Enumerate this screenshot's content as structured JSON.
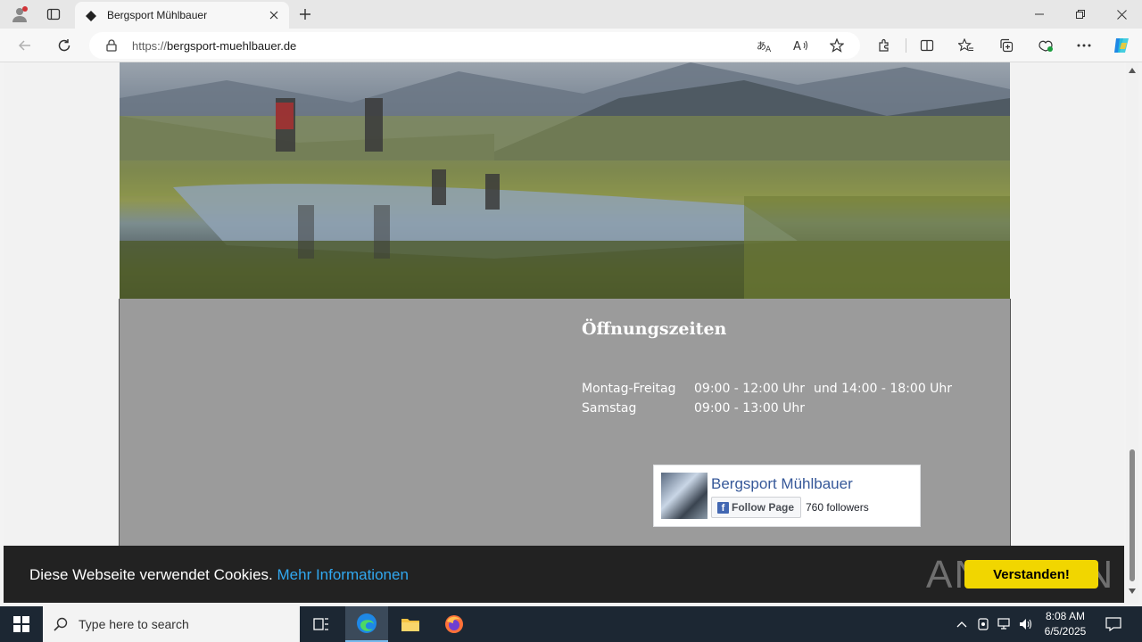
{
  "browser": {
    "tab_title": "Bergsport Mühlbauer",
    "url_scheme": "https://",
    "url_host": "bergsport-muehlbauer.de",
    "icons": [
      "profile-icon",
      "tab-actions-icon",
      "site-favicon",
      "close-icon",
      "new-tab-icon",
      "minimize-icon",
      "restore-icon",
      "window-close-icon",
      "back-icon",
      "refresh-icon",
      "lock-icon",
      "translate-icon",
      "read-aloud-icon",
      "favorite-star-icon",
      "extensions-icon",
      "split-screen-icon",
      "favorites-icon",
      "collections-icon",
      "performance-icon",
      "more-icon",
      "copilot-icon"
    ]
  },
  "page": {
    "hours_title": "Öffnungszeiten",
    "hours": [
      {
        "day": "Montag-Freitag",
        "time": "09:00 - 12:00 Uhr",
        "extra": "und 14:00 - 18:00 Uhr"
      },
      {
        "day": "Samstag",
        "time": "09:00 - 13:00 Uhr",
        "extra": ""
      }
    ],
    "facebook": {
      "page_name": "Bergsport Mühlbauer",
      "follow_label": "Follow Page",
      "followers": "760 followers"
    },
    "cookie": {
      "text": "Diese Webseite verwendet Cookies.",
      "link": "Mehr Informationen",
      "button": "Verstanden!"
    },
    "watermark": "ANY RUN"
  },
  "taskbar": {
    "search_placeholder": "Type here to search",
    "time": "8:08 AM",
    "date": "6/5/2025"
  },
  "colors": {
    "content_bg": "#9b9b9b",
    "cookie_bg": "#222222",
    "cookie_link": "#31a8f0",
    "cookie_button": "#f1d600",
    "facebook_blue": "#365899",
    "taskbar_bg": "#1c2733"
  }
}
